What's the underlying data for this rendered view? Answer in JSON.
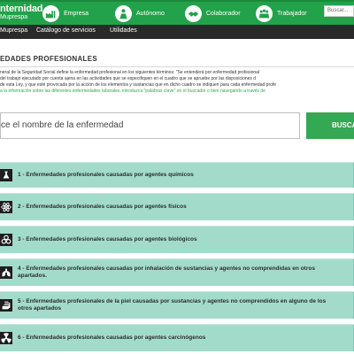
{
  "header": {
    "logo_main": "nternidad",
    "logo_sub": "Muprespa",
    "nav": [
      {
        "label": "Empresa",
        "icon": "factory-icon"
      },
      {
        "label": "Autónomo",
        "icon": "worker-icon"
      },
      {
        "label": "Colaborador",
        "icon": "handshake-icon"
      },
      {
        "label": "Trabajador",
        "icon": "group-icon"
      }
    ],
    "search_placeholder": "Buscar..."
  },
  "subnav": {
    "items": [
      "Muprespa",
      "Catálogo de servicios",
      "Utilidades"
    ]
  },
  "content": {
    "title": "EDADES PROFESIONALES",
    "intro_lines": [
      "neral de la Seguridad Social define la enfermedad profesional en los siguientes términos: \"Se entenderá por enfermedad profesional",
      "del trabajo ejecutado por cuenta ajena en las actividades que se especifiquen en el cuadro que se apruebe por las disposiciones d",
      "de esta Ley, y que esté provocada por la acción de los elementos y sustancias que en dicho cuadro se indiquen para cada enfermedad profe",
      "a la información sobre las diferentes enfermedades laborales, introduzca \"palabras clave\" en el buscador o bien navegando a través de"
    ],
    "search_input_value": "ce el nombre de la enfermedad",
    "search_button_label": "BUSCA"
  },
  "categories": [
    {
      "label": "1 - Enfermedades profesionales causadas por agentes químicos",
      "icon": "flask-icon"
    },
    {
      "label": "2 - Enfermedades profesionales causadas por agentes físicos",
      "icon": "atom-icon"
    },
    {
      "label": "3 - Enfermedades profesionales causadas por agentes biológicos",
      "icon": "biohazard-icon"
    },
    {
      "label": "4 - Enfermedades profesionales causadas por inhalación de sustancias y agentes no comprendidas en otros apartados.",
      "icon": "lungs-icon"
    },
    {
      "label": "5 - Enfermedades profesionales de la piel causadas por sustancias y agentes no comprendidos en alguno de los otros apartados",
      "icon": "hand-icon"
    },
    {
      "label": "6 - Enfermedades profesionales causadas por agentes carcinógenos",
      "icon": "radiation-icon"
    }
  ],
  "colors": {
    "brand_green": "#22a24a",
    "button_green": "#34a853",
    "category_bg": "#a3dbcb",
    "subnav_bg": "#2a2a2a"
  }
}
